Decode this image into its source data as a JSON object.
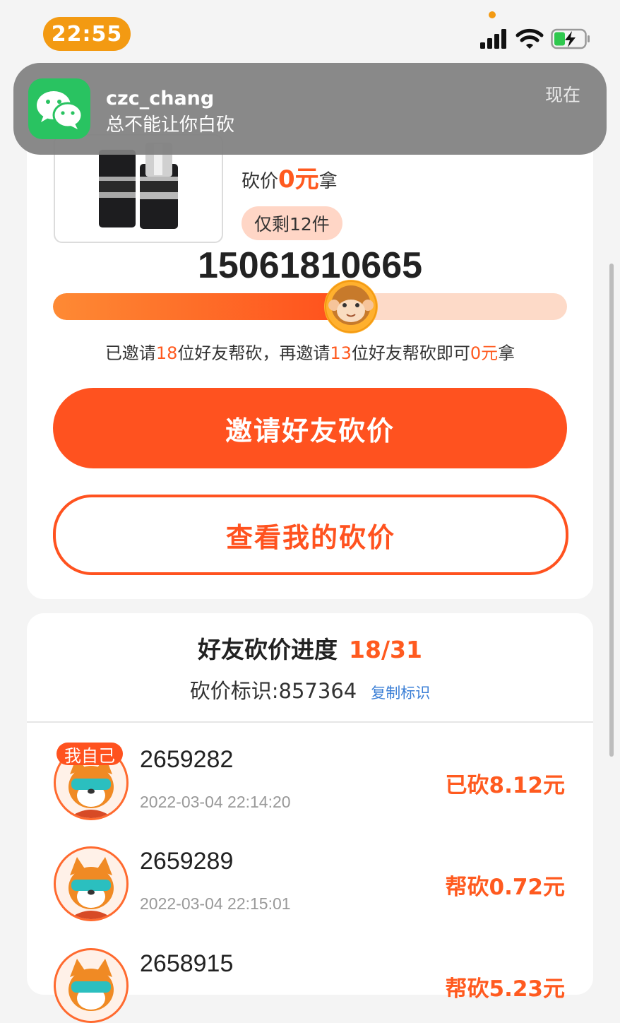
{
  "status": {
    "time": "22:55"
  },
  "notification": {
    "app_icon": "wechat-icon",
    "title": "czc_chang",
    "body": "总不能让你白砍",
    "time": "现在"
  },
  "product": {
    "price_prefix": "砍价",
    "price_value": "0元",
    "price_suffix": "拿",
    "stock_label": "仅剩12件",
    "phone": "15061810665",
    "progress_ratio": 0.58
  },
  "invite": {
    "t1": "已邀请",
    "invited": "18",
    "t2": "位好友帮砍，再邀请",
    "remaining": "13",
    "t3": "位好友帮砍即可",
    "target": "0元",
    "t4": "拿"
  },
  "buttons": {
    "invite": "邀请好友砍价",
    "view": "查看我的砍价"
  },
  "progress": {
    "title": "好友砍价进度",
    "count": "18/31",
    "code_label": "砍价标识:857364",
    "copy_label": "复制标识",
    "rows": [
      {
        "badge": "我自己",
        "id": "2659282",
        "time": "2022-03-04 22:14:20",
        "amount": "已砍8.12元"
      },
      {
        "id": "2659289",
        "time": "2022-03-04 22:15:01",
        "amount": "帮砍0.72元"
      },
      {
        "id": "2658915",
        "amount": "帮砍5.23元"
      }
    ]
  },
  "colors": {
    "accent": "#ff521f",
    "notification_bg": "#808080",
    "wechat": "#29c361"
  }
}
